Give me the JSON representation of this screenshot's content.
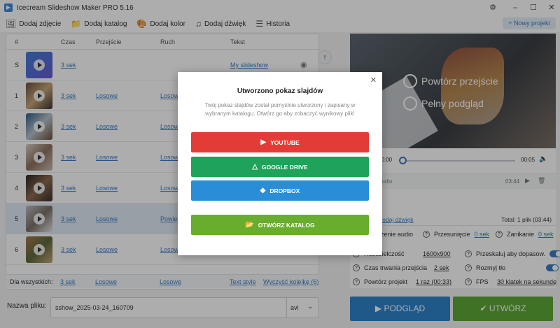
{
  "titlebar": {
    "title": "Icecream Slideshow Maker PRO 5.16"
  },
  "toolbar": {
    "add_photo": "Dodaj zdjęcie",
    "add_folder": "Dodaj katalog",
    "add_color": "Dodaj kolor",
    "add_sound": "Dodaj dźwięk",
    "history": "Historia",
    "new_project": "+ Nowy projekt"
  },
  "table": {
    "headers": [
      "#",
      "Czas",
      "Przejście",
      "Ruch",
      "Tekst"
    ],
    "rows": [
      {
        "num": "S",
        "time": "3 sek",
        "transition": "",
        "motion": "",
        "text": "My slideshow"
      },
      {
        "num": "1",
        "time": "3 sek",
        "transition": "Losowe",
        "motion": "Losowe",
        "text": ""
      },
      {
        "num": "2",
        "time": "3 sek",
        "transition": "Losowe",
        "motion": "Losowe",
        "text": ""
      },
      {
        "num": "3",
        "time": "3 sek",
        "transition": "Losowe",
        "motion": "Losowe",
        "text": ""
      },
      {
        "num": "4",
        "time": "3 sek",
        "transition": "Losowe",
        "motion": "Losowe",
        "text": ""
      },
      {
        "num": "5",
        "time": "3 sek",
        "transition": "Losowe",
        "motion": "Powięk",
        "text": ""
      },
      {
        "num": "6",
        "time": "3 sek",
        "transition": "Losowe",
        "motion": "Losowe",
        "text": ""
      }
    ],
    "footer": {
      "label": "Dla wszystkich:",
      "time": "3 sek",
      "transition": "Losowe",
      "motion": "Losowe",
      "text_style": "Text style",
      "clear": "Wyczyść kolejkę (6)"
    }
  },
  "filename": {
    "label": "Nazwa pliku:",
    "value": "sshow_2025-03-24_160709",
    "format": "avi"
  },
  "preview": {
    "repeat_transition": "Powtórz przejście",
    "full_preview": "Pełny podgląd",
    "time_start": "00:00",
    "time_end": "00:05",
    "audio_label": "Audio",
    "audio_time": "03:44",
    "add_sound": "Dodaj dźwięk",
    "total": "Total: 1 plik (03:44)"
  },
  "settings": {
    "audio_fade_label": "Wyciszenie audio",
    "shift_label": "Przesunięcie",
    "shift_value": "0 sek",
    "fade_label": "Zanikanie",
    "fade_value": "0 sek",
    "resolution_label": "Rozdzielczość",
    "resolution_value": "1600x900",
    "scale_label": "Przeskaluj aby dopasow.",
    "transition_duration_label": "Czas trwania przejścia",
    "transition_duration_value": "2 sek",
    "blur_label": "Rozmyj tło",
    "repeat_project_label": "Powtórz projekt",
    "repeat_project_value": "1 raz (00:33)",
    "fps_label": "FPS",
    "fps_value": "30 klatek na sekundę"
  },
  "buttons": {
    "preview": "PODGLĄD",
    "create": "UTWÓRZ"
  },
  "modal": {
    "title": "Utworzono pokaz slajdów",
    "desc": "Twój pokaz slajdów został pomyślnie utworzony i zapisany w wybranym katalogu. Otwórz go aby zobaczyć wynikowy plik!",
    "youtube": "YOUTUBE",
    "gdrive": "GOOGLE DRIVE",
    "dropbox": "DROPBOX",
    "open_folder": "OTWÓRZ KATALOG"
  },
  "colors": {
    "youtube": "#e33b35",
    "gdrive": "#1fa25a",
    "dropbox": "#2a8dd8",
    "folder": "#69ad2e",
    "accent": "#3b7cc4",
    "create": "#5ea836",
    "preview_btn": "#2e83cc"
  }
}
